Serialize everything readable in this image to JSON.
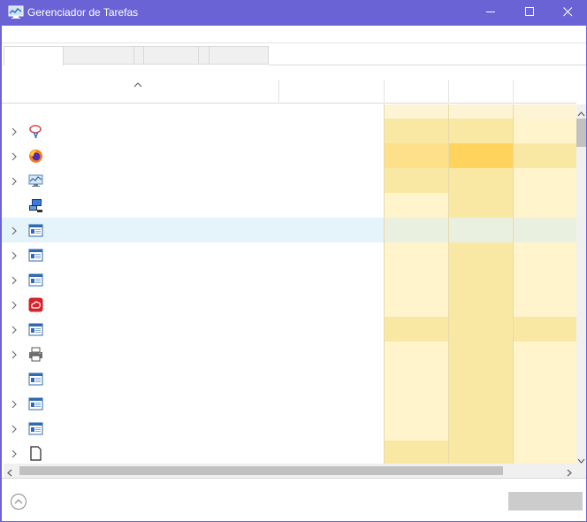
{
  "window": {
    "title": "Gerenciador de Tarefas",
    "accent_color": "#6a63d6",
    "icon": "task-manager-icon"
  },
  "titlebar_buttons": [
    "minimize-icon",
    "maximize-icon",
    "close-icon"
  ],
  "tabs": [
    {
      "label": "",
      "active": true
    },
    {
      "label": "",
      "active": false
    },
    {
      "label": "",
      "active": false
    },
    {
      "label": "",
      "active": false
    },
    {
      "label": "",
      "active": false
    },
    {
      "label": "",
      "active": false
    }
  ],
  "header": {
    "sort_indicator": "sort-ascending-icon"
  },
  "heat_colors": {
    "very_light": "#fdf4d6",
    "light": "#fff4cc",
    "medium": "#f9e8a4",
    "strong": "#ffe08a",
    "hot": "#ffd35c",
    "selected_cell": "#eaf0e0"
  },
  "rows": [
    {
      "icon": "snipping-tool-icon",
      "expandable": true,
      "selected": false,
      "heat": [
        "medium",
        "medium",
        "light"
      ]
    },
    {
      "icon": "firefox-icon",
      "expandable": true,
      "selected": false,
      "heat": [
        "strong",
        "hot",
        "medium"
      ]
    },
    {
      "icon": "task-manager-icon",
      "expandable": true,
      "selected": false,
      "heat": [
        "medium",
        "medium",
        "light"
      ]
    },
    {
      "icon": "network-computer-icon",
      "expandable": false,
      "selected": false,
      "heat": [
        "light",
        "medium",
        "light"
      ]
    },
    {
      "icon": "window-app-icon",
      "expandable": true,
      "selected": true,
      "heat": [
        "selected",
        "selected",
        "selected"
      ]
    },
    {
      "icon": "window-app-icon",
      "expandable": true,
      "selected": false,
      "heat": [
        "light",
        "medium",
        "light"
      ]
    },
    {
      "icon": "window-app-icon",
      "expandable": true,
      "selected": false,
      "heat": [
        "light",
        "medium",
        "light"
      ]
    },
    {
      "icon": "creative-cloud-icon",
      "expandable": true,
      "selected": false,
      "heat": [
        "light",
        "medium",
        "light"
      ]
    },
    {
      "icon": "window-app-icon",
      "expandable": true,
      "selected": false,
      "heat": [
        "medium",
        "medium",
        "medium"
      ]
    },
    {
      "icon": "printer-icon",
      "expandable": true,
      "selected": false,
      "heat": [
        "light",
        "medium",
        "light"
      ]
    },
    {
      "icon": "window-app-icon",
      "expandable": false,
      "selected": false,
      "heat": [
        "light",
        "medium",
        "light"
      ]
    },
    {
      "icon": "window-app-icon",
      "expandable": true,
      "selected": false,
      "heat": [
        "light",
        "medium",
        "light"
      ]
    },
    {
      "icon": "window-app-icon",
      "expandable": true,
      "selected": false,
      "heat": [
        "light",
        "medium",
        "light"
      ]
    },
    {
      "icon": "document-icon",
      "expandable": true,
      "selected": false,
      "heat": [
        "medium",
        "medium",
        "light"
      ]
    }
  ],
  "footer": {
    "fewer_details_icon": "chevron-up-circle-icon",
    "end_task_label": ""
  }
}
